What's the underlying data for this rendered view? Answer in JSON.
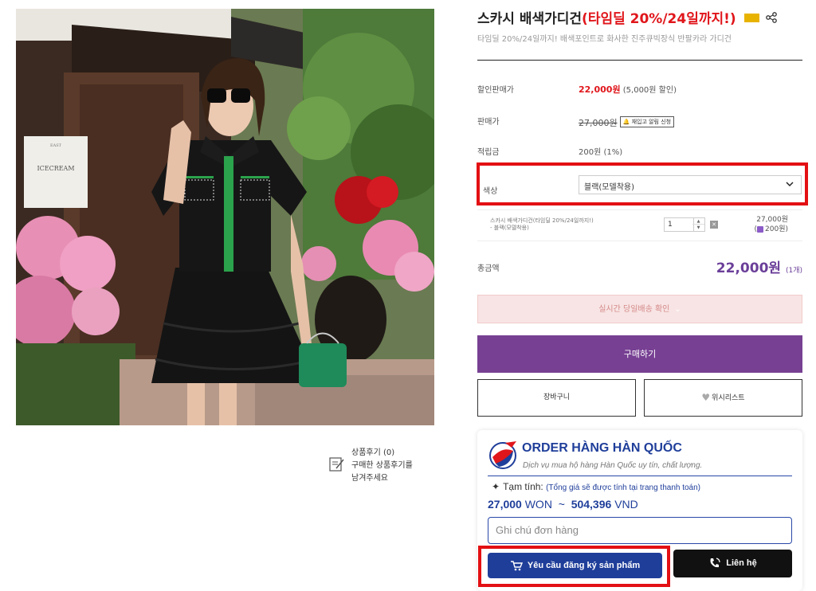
{
  "product": {
    "title_main": "스카시 배색가디건",
    "title_highlight": "(타임딜 20%/24일까지!)",
    "subtitle": "타임딜 20%/24일까지! 배색포인트로 화사한 진주큐빅장식 반팔카라 가디건",
    "sale_price_label": "할인판매가",
    "sale_price": "22,000원",
    "sale_note": "(5,000원 할인)",
    "price_label": "판매가",
    "price": "27,000원",
    "restock_label": "재입고 알림 신청",
    "points_label": "적립금",
    "points": "200원 (1%)",
    "color_label": "색상",
    "color_value": "블랙(모델착용)",
    "option_name_line1": "스카시 배색가디건(타임딜 20%/24일까지!)",
    "option_name_line2": "- 블랙(모델착용)",
    "quantity": "1",
    "option_price": "27,000원",
    "option_points": "200원)",
    "option_points_prefix": "(",
    "total_label": "총금액",
    "total_value": "22,000원",
    "total_count": "(1개)"
  },
  "buttons": {
    "delivery": "실시간 당일배송 확인",
    "buy": "구매하기",
    "cart": "장바구니",
    "wishlist": "위시리스트"
  },
  "review": {
    "count": "상품후기 (0)",
    "line1": "구매한 상품후기를",
    "line2": "남겨주세요"
  },
  "order_widget": {
    "title": "ORDER HÀNG HÀN QUỐC",
    "subtitle": "Dịch vụ mua hộ hàng Hàn Quốc uy tín, chất lượng.",
    "estimate_label": "Tạm tính:",
    "estimate_note": "(Tổng giá sẽ được tính tại trang thanh toán)",
    "won_amount": "27,000",
    "won_unit": "WON",
    "separator": "~",
    "vnd_amount": "504,396",
    "vnd_unit": "VND",
    "note_placeholder": "Ghi chú đơn hàng",
    "register_label": "Yêu cầu đăng ký sản phẩm",
    "contact_label": "Liên hệ"
  },
  "photo": {
    "sign_text": "ICECREAM",
    "sign_small": "EAST"
  },
  "colors": {
    "accent_red": "#e0161b",
    "purple": "#774093",
    "navy": "#1f3e9a",
    "highlight_box": "#e31013"
  }
}
